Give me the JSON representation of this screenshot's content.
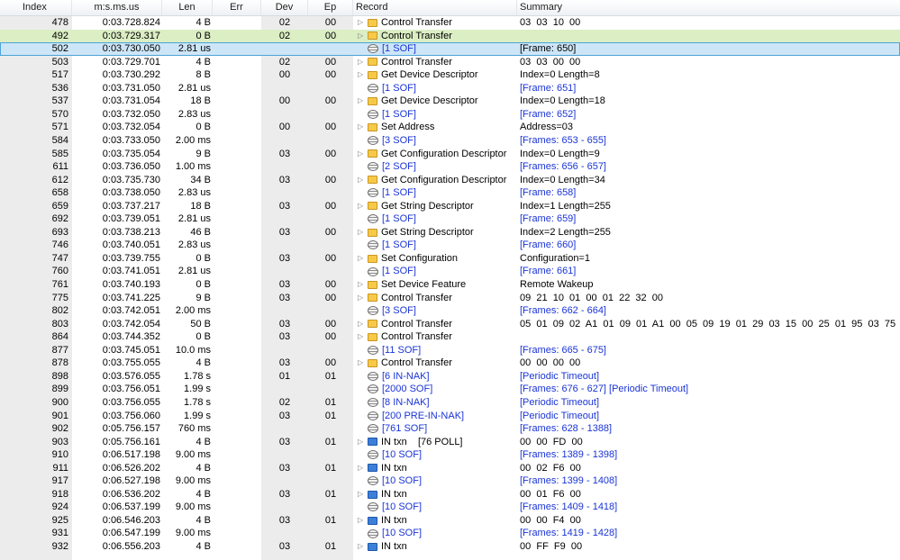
{
  "columns": [
    "Index",
    "m:s.ms.us",
    "Len",
    "Err",
    "Dev",
    "Ep",
    "Record",
    "Summary"
  ],
  "rows": [
    {
      "index": "478",
      "time": "0:03.728.824",
      "len": "4 B",
      "dev": "02",
      "ep": "00",
      "expand": true,
      "icon": "ctrl",
      "record": "Control Transfer",
      "summary": "03  03  10  00",
      "link": false,
      "hl": ""
    },
    {
      "index": "492",
      "time": "0:03.729.317",
      "len": "0 B",
      "dev": "02",
      "ep": "00",
      "expand": true,
      "icon": "ctrl",
      "record": "Control Transfer",
      "summary": "",
      "link": false,
      "hl": "green"
    },
    {
      "index": "502",
      "time": "0:03.730.050",
      "len": "2.81 us",
      "dev": "",
      "ep": "",
      "expand": false,
      "icon": "sof",
      "record": "[1 SOF]",
      "summary": "[Frame: 650]",
      "link": false,
      "hl": "blue"
    },
    {
      "index": "503",
      "time": "0:03.729.701",
      "len": "4 B",
      "dev": "02",
      "ep": "00",
      "expand": true,
      "icon": "ctrl",
      "record": "Control Transfer",
      "summary": "03  03  00  00",
      "link": false,
      "hl": ""
    },
    {
      "index": "517",
      "time": "0:03.730.292",
      "len": "8 B",
      "dev": "00",
      "ep": "00",
      "expand": true,
      "icon": "ctrl",
      "record": "Get Device Descriptor",
      "summary": "Index=0 Length=8",
      "link": false,
      "hl": ""
    },
    {
      "index": "536",
      "time": "0:03.731.050",
      "len": "2.81 us",
      "dev": "",
      "ep": "",
      "expand": false,
      "icon": "sof",
      "record": "[1 SOF]",
      "summary": "[Frame: 651]",
      "link": true,
      "hl": ""
    },
    {
      "index": "537",
      "time": "0:03.731.054",
      "len": "18 B",
      "dev": "00",
      "ep": "00",
      "expand": true,
      "icon": "ctrl",
      "record": "Get Device Descriptor",
      "summary": "Index=0 Length=18",
      "link": false,
      "hl": ""
    },
    {
      "index": "570",
      "time": "0:03.732.050",
      "len": "2.83 us",
      "dev": "",
      "ep": "",
      "expand": false,
      "icon": "sof",
      "record": "[1 SOF]",
      "summary": "[Frame: 652]",
      "link": true,
      "hl": ""
    },
    {
      "index": "571",
      "time": "0:03.732.054",
      "len": "0 B",
      "dev": "00",
      "ep": "00",
      "expand": true,
      "icon": "ctrl",
      "record": "Set Address",
      "summary": "Address=03",
      "link": false,
      "hl": ""
    },
    {
      "index": "584",
      "time": "0:03.733.050",
      "len": "2.00 ms",
      "dev": "",
      "ep": "",
      "expand": false,
      "icon": "sof",
      "record": "[3 SOF]",
      "summary": "[Frames: 653 - 655]",
      "link": true,
      "hl": ""
    },
    {
      "index": "585",
      "time": "0:03.735.054",
      "len": "9 B",
      "dev": "03",
      "ep": "00",
      "expand": true,
      "icon": "ctrl",
      "record": "Get Configuration Descriptor",
      "summary": "Index=0 Length=9",
      "link": false,
      "hl": ""
    },
    {
      "index": "611",
      "time": "0:03.736.050",
      "len": "1.00 ms",
      "dev": "",
      "ep": "",
      "expand": false,
      "icon": "sof",
      "record": "[2 SOF]",
      "summary": "[Frames: 656 - 657]",
      "link": true,
      "hl": ""
    },
    {
      "index": "612",
      "time": "0:03.735.730",
      "len": "34 B",
      "dev": "03",
      "ep": "00",
      "expand": true,
      "icon": "ctrl",
      "record": "Get Configuration Descriptor",
      "summary": "Index=0 Length=34",
      "link": false,
      "hl": ""
    },
    {
      "index": "658",
      "time": "0:03.738.050",
      "len": "2.83 us",
      "dev": "",
      "ep": "",
      "expand": false,
      "icon": "sof",
      "record": "[1 SOF]",
      "summary": "[Frame: 658]",
      "link": true,
      "hl": ""
    },
    {
      "index": "659",
      "time": "0:03.737.217",
      "len": "18 B",
      "dev": "03",
      "ep": "00",
      "expand": true,
      "icon": "ctrl",
      "record": "Get String Descriptor",
      "summary": "Index=1 Length=255",
      "link": false,
      "hl": ""
    },
    {
      "index": "692",
      "time": "0:03.739.051",
      "len": "2.81 us",
      "dev": "",
      "ep": "",
      "expand": false,
      "icon": "sof",
      "record": "[1 SOF]",
      "summary": "[Frame: 659]",
      "link": true,
      "hl": ""
    },
    {
      "index": "693",
      "time": "0:03.738.213",
      "len": "46 B",
      "dev": "03",
      "ep": "00",
      "expand": true,
      "icon": "ctrl",
      "record": "Get String Descriptor",
      "summary": "Index=2 Length=255",
      "link": false,
      "hl": ""
    },
    {
      "index": "746",
      "time": "0:03.740.051",
      "len": "2.83 us",
      "dev": "",
      "ep": "",
      "expand": false,
      "icon": "sof",
      "record": "[1 SOF]",
      "summary": "[Frame: 660]",
      "link": true,
      "hl": ""
    },
    {
      "index": "747",
      "time": "0:03.739.755",
      "len": "0 B",
      "dev": "03",
      "ep": "00",
      "expand": true,
      "icon": "ctrl",
      "record": "Set Configuration",
      "summary": "Configuration=1",
      "link": false,
      "hl": ""
    },
    {
      "index": "760",
      "time": "0:03.741.051",
      "len": "2.81 us",
      "dev": "",
      "ep": "",
      "expand": false,
      "icon": "sof",
      "record": "[1 SOF]",
      "summary": "[Frame: 661]",
      "link": true,
      "hl": ""
    },
    {
      "index": "761",
      "time": "0:03.740.193",
      "len": "0 B",
      "dev": "03",
      "ep": "00",
      "expand": true,
      "icon": "ctrl",
      "record": "Set Device Feature",
      "summary": "Remote Wakeup",
      "link": false,
      "hl": ""
    },
    {
      "index": "775",
      "time": "0:03.741.225",
      "len": "9 B",
      "dev": "03",
      "ep": "00",
      "expand": true,
      "icon": "ctrl",
      "record": "Control Transfer",
      "summary": "09  21  10  01  00  01  22  32  00",
      "link": false,
      "hl": ""
    },
    {
      "index": "802",
      "time": "0:03.742.051",
      "len": "2.00 ms",
      "dev": "",
      "ep": "",
      "expand": false,
      "icon": "sof",
      "record": "[3 SOF]",
      "summary": "[Frames: 662 - 664]",
      "link": true,
      "hl": ""
    },
    {
      "index": "803",
      "time": "0:03.742.054",
      "len": "50 B",
      "dev": "03",
      "ep": "00",
      "expand": true,
      "icon": "ctrl",
      "record": "Control Transfer",
      "summary": "05  01  09  02  A1  01  09  01  A1  00  05  09  19  01  29  03  15  00  25  01  95  03  75  01...",
      "link": false,
      "hl": ""
    },
    {
      "index": "864",
      "time": "0:03.744.352",
      "len": "0 B",
      "dev": "03",
      "ep": "00",
      "expand": true,
      "icon": "ctrl",
      "record": "Control Transfer",
      "summary": "",
      "link": false,
      "hl": ""
    },
    {
      "index": "877",
      "time": "0:03.745.051",
      "len": "10.0 ms",
      "dev": "",
      "ep": "",
      "expand": false,
      "icon": "sof",
      "record": "[11 SOF]",
      "summary": "[Frames: 665 - 675]",
      "link": true,
      "hl": ""
    },
    {
      "index": "878",
      "time": "0:03.755.055",
      "len": "4 B",
      "dev": "03",
      "ep": "00",
      "expand": true,
      "icon": "ctrl",
      "record": "Control Transfer",
      "summary": "00  00  00  00",
      "link": false,
      "hl": ""
    },
    {
      "index": "898",
      "time": "0:03.576.055",
      "len": "1.78 s",
      "dev": "01",
      "ep": "01",
      "expand": false,
      "icon": "sof",
      "record": "[6 IN-NAK]",
      "summary": "[Periodic Timeout]",
      "link": true,
      "hl": ""
    },
    {
      "index": "899",
      "time": "0:03.756.051",
      "len": "1.99 s",
      "dev": "",
      "ep": "",
      "expand": false,
      "icon": "sof",
      "record": "[2000 SOF]",
      "summary": "[Frames: 676 - 627] [Periodic Timeout]",
      "link": true,
      "hl": ""
    },
    {
      "index": "900",
      "time": "0:03.756.055",
      "len": "1.78 s",
      "dev": "02",
      "ep": "01",
      "expand": false,
      "icon": "sof",
      "record": "[8 IN-NAK]",
      "summary": "[Periodic Timeout]",
      "link": true,
      "hl": ""
    },
    {
      "index": "901",
      "time": "0:03.756.060",
      "len": "1.99 s",
      "dev": "03",
      "ep": "01",
      "expand": false,
      "icon": "sof",
      "record": "[200 PRE-IN-NAK]",
      "summary": "[Periodic Timeout]",
      "link": true,
      "hl": ""
    },
    {
      "index": "902",
      "time": "0:05.756.157",
      "len": "760 ms",
      "dev": "",
      "ep": "",
      "expand": false,
      "icon": "sof",
      "record": "[761 SOF]",
      "summary": "[Frames: 628 - 1388]",
      "link": true,
      "hl": ""
    },
    {
      "index": "903",
      "time": "0:05.756.161",
      "len": "4 B",
      "dev": "03",
      "ep": "01",
      "expand": true,
      "icon": "intxn",
      "record": "IN txn    [76 POLL]",
      "summary": "00  00  FD  00",
      "link": false,
      "hl": ""
    },
    {
      "index": "910",
      "time": "0:06.517.198",
      "len": "9.00 ms",
      "dev": "",
      "ep": "",
      "expand": false,
      "icon": "sof",
      "record": "[10 SOF]",
      "summary": "[Frames: 1389 - 1398]",
      "link": true,
      "hl": ""
    },
    {
      "index": "911",
      "time": "0:06.526.202",
      "len": "4 B",
      "dev": "03",
      "ep": "01",
      "expand": true,
      "icon": "intxn",
      "record": "IN txn",
      "summary": "00  02  F6  00",
      "link": false,
      "hl": ""
    },
    {
      "index": "917",
      "time": "0:06.527.198",
      "len": "9.00 ms",
      "dev": "",
      "ep": "",
      "expand": false,
      "icon": "sof",
      "record": "[10 SOF]",
      "summary": "[Frames: 1399 - 1408]",
      "link": true,
      "hl": ""
    },
    {
      "index": "918",
      "time": "0:06.536.202",
      "len": "4 B",
      "dev": "03",
      "ep": "01",
      "expand": true,
      "icon": "intxn",
      "record": "IN txn",
      "summary": "00  01  F6  00",
      "link": false,
      "hl": ""
    },
    {
      "index": "924",
      "time": "0:06.537.199",
      "len": "9.00 ms",
      "dev": "",
      "ep": "",
      "expand": false,
      "icon": "sof",
      "record": "[10 SOF]",
      "summary": "[Frames: 1409 - 1418]",
      "link": true,
      "hl": ""
    },
    {
      "index": "925",
      "time": "0:06.546.203",
      "len": "4 B",
      "dev": "03",
      "ep": "01",
      "expand": true,
      "icon": "intxn",
      "record": "IN txn",
      "summary": "00  00  F4  00",
      "link": false,
      "hl": ""
    },
    {
      "index": "931",
      "time": "0:06.547.199",
      "len": "9.00 ms",
      "dev": "",
      "ep": "",
      "expand": false,
      "icon": "sof",
      "record": "[10 SOF]",
      "summary": "[Frames: 1419 - 1428]",
      "link": true,
      "hl": ""
    },
    {
      "index": "932",
      "time": "0:06.556.203",
      "len": "4 B",
      "dev": "03",
      "ep": "01",
      "expand": true,
      "icon": "intxn",
      "record": "IN txn",
      "summary": "00  FF  F9  00",
      "link": false,
      "hl": ""
    }
  ],
  "icons": {
    "expander": "triangle-right-icon",
    "ctrl": "folder-icon",
    "sof": "sof-stack-icon",
    "intxn": "in-transaction-icon"
  },
  "colors": {
    "selected_row": "#cde6f7",
    "green_row": "#dbeec4",
    "link_text": "#1a34d6",
    "shaded_column": "#ececec"
  }
}
